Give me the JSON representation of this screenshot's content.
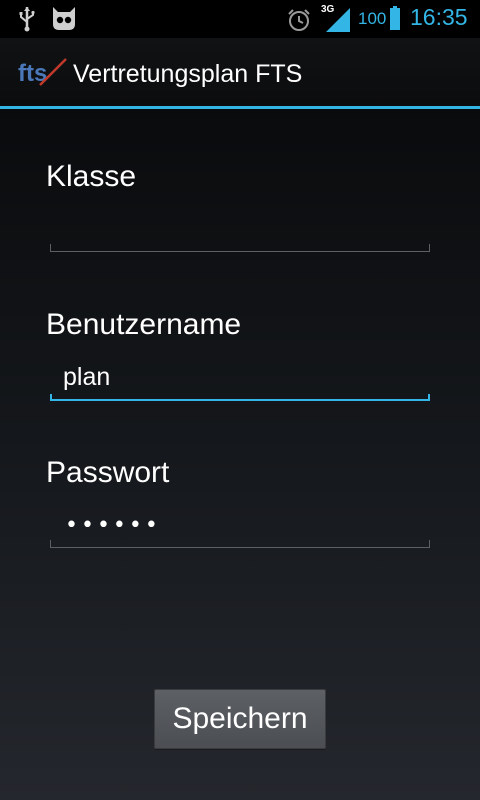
{
  "status_bar": {
    "network_type": "3G",
    "battery_level": "100",
    "time": "16:35",
    "icons": [
      "usb-icon",
      "cyanogenmod-icon",
      "alarm-icon",
      "signal-icon",
      "battery-icon"
    ],
    "accent_color": "#33b5e5"
  },
  "action_bar": {
    "title": "Vertretungsplan FTS",
    "icon": "app-logo-icon"
  },
  "form": {
    "klasse": {
      "label": "Klasse",
      "value": ""
    },
    "benutzername": {
      "label": "Benutzername",
      "value": "plan"
    },
    "passwort": {
      "label": "Passwort",
      "masked_value": "••••••"
    }
  },
  "buttons": {
    "save_label": "Speichern"
  }
}
